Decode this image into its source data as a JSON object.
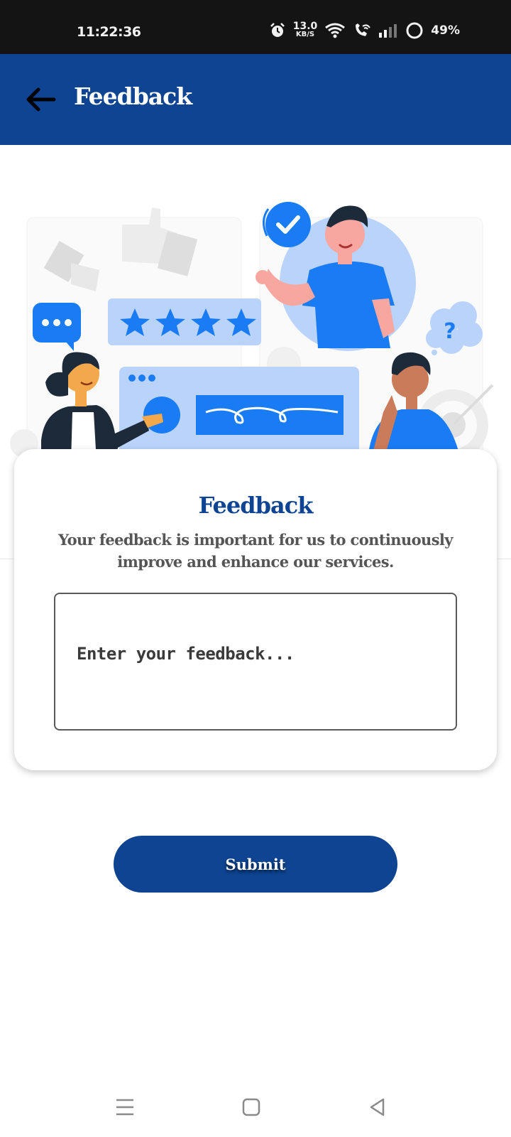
{
  "status_bar": {
    "time": "11:22:36",
    "net_speed_value": "13.0",
    "net_speed_unit": "KB/S",
    "battery": "49%"
  },
  "app_bar": {
    "title": "Feedback",
    "back_icon": "arrow-left-icon"
  },
  "card": {
    "title": "Feedback",
    "subtitle": "Your feedback is important for us to continuously improve and enhance our services.",
    "feedback_placeholder": "Enter your feedback...",
    "feedback_value": ""
  },
  "submit_label": "Submit",
  "nav_bar": {
    "icons": [
      "menu-icon",
      "home-square-icon",
      "back-triangle-icon"
    ]
  },
  "colors": {
    "primary": "#0e4491",
    "accent_blue": "#1a7cf5",
    "light_blue": "#b9d3fb"
  }
}
